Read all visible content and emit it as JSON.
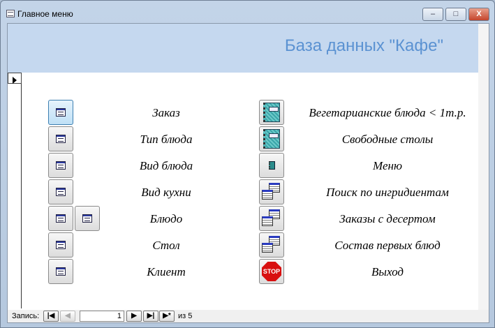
{
  "window": {
    "title": "Главное меню",
    "minimize": "–",
    "maximize": "□",
    "close": "X"
  },
  "header": {
    "title": "База данных \"Кафе\""
  },
  "left_buttons": [
    {
      "label": "Заказ"
    },
    {
      "label": "Тип блюда"
    },
    {
      "label": "Вид блюда"
    },
    {
      "label": "Вид кухни"
    },
    {
      "label": "Блюдо"
    },
    {
      "label": "Стол"
    },
    {
      "label": "Клиент"
    }
  ],
  "right_buttons": [
    {
      "label": "Вегетарианские блюда < 1т.р.",
      "icon": "report-icon"
    },
    {
      "label": "Свободные столы",
      "icon": "report-icon"
    },
    {
      "label": "Меню",
      "icon": "report-small-icon"
    },
    {
      "label": "Поиск по ингридиентам",
      "icon": "query-icon"
    },
    {
      "label": "Заказы с десертом",
      "icon": "query-icon"
    },
    {
      "label": "Состав первых блюд",
      "icon": "query-icon"
    },
    {
      "label": "Выход",
      "icon": "stop-icon",
      "icon_text": "STOP"
    }
  ],
  "navigation": {
    "label": "Запись:",
    "current": "1",
    "of_label": "из 5",
    "first": "|◀",
    "prev": "◀",
    "next": "▶",
    "last": "▶|",
    "new": "▶*"
  }
}
